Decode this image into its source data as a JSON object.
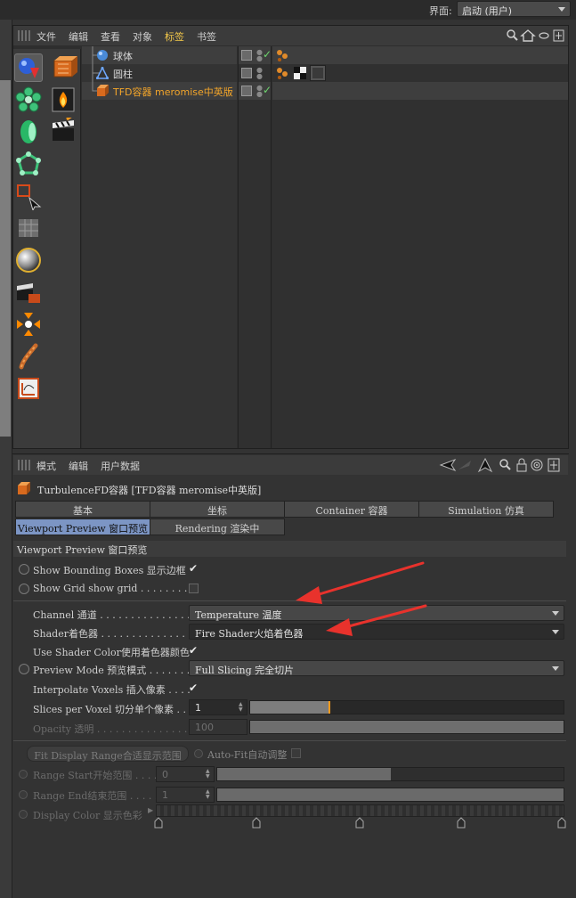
{
  "interface": {
    "label": "界面:",
    "value": "启动 (用户)"
  },
  "object_manager": {
    "menu": [
      "文件",
      "编辑",
      "查看",
      "对象",
      "标签",
      "书签"
    ],
    "active_menu_index": 4,
    "objects": [
      {
        "name": "球体",
        "icon": "sphere-icon",
        "check": "✓"
      },
      {
        "name": "圆柱",
        "icon": "cylinder-icon",
        "check": ""
      },
      {
        "name": "TFD容器 meromise中英版",
        "icon": "tfd-container-icon",
        "check": "✓"
      }
    ],
    "palette_icons": [
      "cube-arrow-icon",
      "tfd-container-tool-icon",
      "cloner-icon",
      "fire-icon",
      "capsule-icon",
      "clapper-icon",
      "polygon-select-icon",
      "rect-select-icon",
      "grid-object-icon",
      "material-sphere-icon",
      "render-icon",
      "axis-icon",
      "spline-icon",
      "timeline-icon"
    ]
  },
  "attribute_manager": {
    "menu": [
      "模式",
      "编辑",
      "用户数据"
    ],
    "title": "TurbulenceFD容器 [TFD容器 meromise中英版]",
    "tabs_row1": [
      "基本",
      "坐标",
      "Container 容器",
      "Simulation 仿真"
    ],
    "tabs_row2": [
      "Viewport Preview 窗口预览",
      "Rendering 渲染中"
    ],
    "active_tab": "Viewport Preview 窗口预览",
    "section": "Viewport Preview 窗口预览",
    "bounding_label": "Show Bounding Boxes 显示边框",
    "bounding_checked": true,
    "grid_label": "Show Grid show grid . . . . . . . . .",
    "grid_checked": false,
    "channel_label": "Channel 通道 . . . . . . . . . . . . . . . . .",
    "channel_value": "Temperature 温度",
    "shader_label": "Shader着色器 . . . . . . . . . . . . . . . .",
    "shader_value": "Fire Shader火焰着色器",
    "use_shader_label": "Use Shader Color使用着色器颜色",
    "use_shader_checked": true,
    "preview_mode_label": "Preview Mode 预览模式 . . . . . . .",
    "preview_mode_value": "Full Slicing 完全切片",
    "interpolate_label": "Interpolate Voxels 插入像素 . . . .",
    "interpolate_checked": true,
    "slices_label": "Slices per Voxel 切分单个像素 . .",
    "slices_value": "1",
    "slices_fill_fraction": 0.25,
    "opacity_label": "Opacity 透明 . . . . . . . . . . . . . . . . .",
    "opacity_value": "100",
    "fit_button": "Fit Display Range合适显示范围",
    "autofit_label": "Auto-Fit自动调整",
    "range_start_label": "Range Start开始范围 . . . . .",
    "range_start_value": "0",
    "range_start_fill_fraction": 0.5,
    "range_end_label": "Range End结束范围 . . . . .",
    "range_end_value": "1",
    "range_end_fill_fraction": 1.0,
    "display_color_label": "Display Color 显示色彩"
  },
  "colors": {
    "accent_orange": "#f3a52a",
    "active_menu": "#f3c84a",
    "tab_active": "#7c95c4",
    "annotation_arrow": "#e8322c",
    "slider_marker": "#ff9a1a"
  }
}
